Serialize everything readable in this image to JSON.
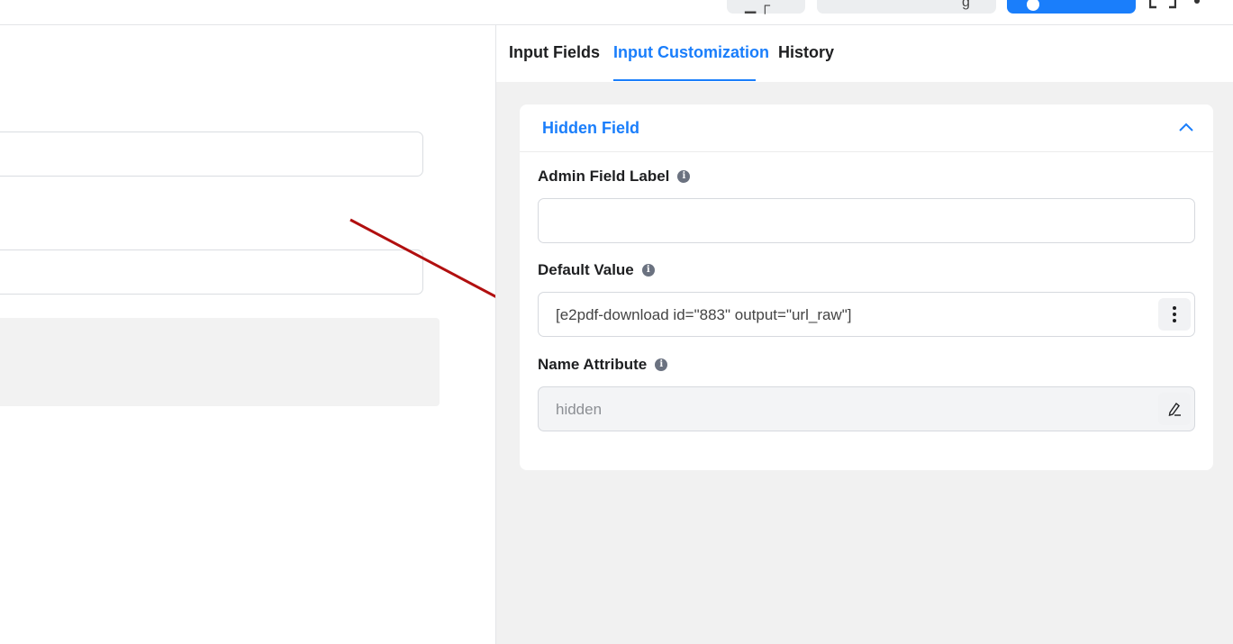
{
  "tabs": [
    {
      "label": "Input Fields"
    },
    {
      "label": "Input Customization"
    },
    {
      "label": "History"
    }
  ],
  "active_tab": "Input Customization",
  "card": {
    "title": "Hidden Field",
    "fields": [
      {
        "label": "Admin Field Label",
        "value": ""
      },
      {
        "label": "Default Value",
        "value": "[e2pdf-download id=\"883\" output=\"url_raw\"]"
      },
      {
        "label": "Name Attribute",
        "value": "hidden"
      }
    ]
  },
  "icons": {
    "info": "info-icon",
    "collapse": "chevron-up-icon",
    "more": "vertical-dots-icon",
    "edit": "pencil-edit-icon",
    "expand": "fullscreen-icon"
  },
  "colors": {
    "accent": "#1a7efb",
    "annotation_arrow": "#b10f0f",
    "panel_bg": "#f1f1f1"
  }
}
